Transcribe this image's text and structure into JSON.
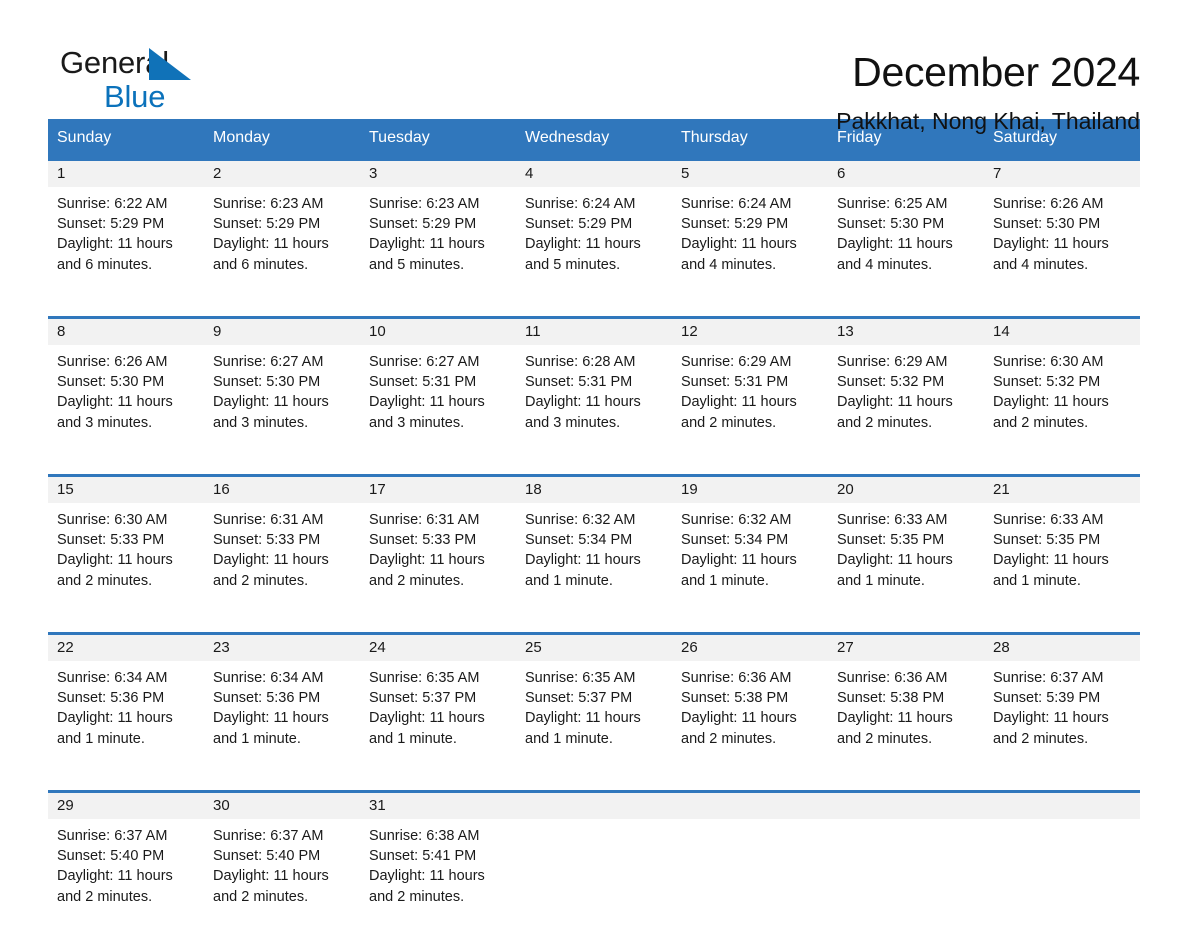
{
  "brand": {
    "name_part1": "General",
    "name_part2": "Blue",
    "triangle_icon": "triangle-icon",
    "accent_color": "#1072b8"
  },
  "header": {
    "title": "December 2024",
    "subtitle": "Pakkhat, Nong Khai, Thailand"
  },
  "theme": {
    "header_blue": "#3077bc",
    "day_band_gray": "#f2f2f2",
    "text": "#1a1a1a"
  },
  "weekdays": [
    "Sunday",
    "Monday",
    "Tuesday",
    "Wednesday",
    "Thursday",
    "Friday",
    "Saturday"
  ],
  "weeks": [
    [
      {
        "day": "1",
        "sunrise": "Sunrise: 6:22 AM",
        "sunset": "Sunset: 5:29 PM",
        "daylight": "Daylight: 11 hours and 6 minutes."
      },
      {
        "day": "2",
        "sunrise": "Sunrise: 6:23 AM",
        "sunset": "Sunset: 5:29 PM",
        "daylight": "Daylight: 11 hours and 6 minutes."
      },
      {
        "day": "3",
        "sunrise": "Sunrise: 6:23 AM",
        "sunset": "Sunset: 5:29 PM",
        "daylight": "Daylight: 11 hours and 5 minutes."
      },
      {
        "day": "4",
        "sunrise": "Sunrise: 6:24 AM",
        "sunset": "Sunset: 5:29 PM",
        "daylight": "Daylight: 11 hours and 5 minutes."
      },
      {
        "day": "5",
        "sunrise": "Sunrise: 6:24 AM",
        "sunset": "Sunset: 5:29 PM",
        "daylight": "Daylight: 11 hours and 4 minutes."
      },
      {
        "day": "6",
        "sunrise": "Sunrise: 6:25 AM",
        "sunset": "Sunset: 5:30 PM",
        "daylight": "Daylight: 11 hours and 4 minutes."
      },
      {
        "day": "7",
        "sunrise": "Sunrise: 6:26 AM",
        "sunset": "Sunset: 5:30 PM",
        "daylight": "Daylight: 11 hours and 4 minutes."
      }
    ],
    [
      {
        "day": "8",
        "sunrise": "Sunrise: 6:26 AM",
        "sunset": "Sunset: 5:30 PM",
        "daylight": "Daylight: 11 hours and 3 minutes."
      },
      {
        "day": "9",
        "sunrise": "Sunrise: 6:27 AM",
        "sunset": "Sunset: 5:30 PM",
        "daylight": "Daylight: 11 hours and 3 minutes."
      },
      {
        "day": "10",
        "sunrise": "Sunrise: 6:27 AM",
        "sunset": "Sunset: 5:31 PM",
        "daylight": "Daylight: 11 hours and 3 minutes."
      },
      {
        "day": "11",
        "sunrise": "Sunrise: 6:28 AM",
        "sunset": "Sunset: 5:31 PM",
        "daylight": "Daylight: 11 hours and 3 minutes."
      },
      {
        "day": "12",
        "sunrise": "Sunrise: 6:29 AM",
        "sunset": "Sunset: 5:31 PM",
        "daylight": "Daylight: 11 hours and 2 minutes."
      },
      {
        "day": "13",
        "sunrise": "Sunrise: 6:29 AM",
        "sunset": "Sunset: 5:32 PM",
        "daylight": "Daylight: 11 hours and 2 minutes."
      },
      {
        "day": "14",
        "sunrise": "Sunrise: 6:30 AM",
        "sunset": "Sunset: 5:32 PM",
        "daylight": "Daylight: 11 hours and 2 minutes."
      }
    ],
    [
      {
        "day": "15",
        "sunrise": "Sunrise: 6:30 AM",
        "sunset": "Sunset: 5:33 PM",
        "daylight": "Daylight: 11 hours and 2 minutes."
      },
      {
        "day": "16",
        "sunrise": "Sunrise: 6:31 AM",
        "sunset": "Sunset: 5:33 PM",
        "daylight": "Daylight: 11 hours and 2 minutes."
      },
      {
        "day": "17",
        "sunrise": "Sunrise: 6:31 AM",
        "sunset": "Sunset: 5:33 PM",
        "daylight": "Daylight: 11 hours and 2 minutes."
      },
      {
        "day": "18",
        "sunrise": "Sunrise: 6:32 AM",
        "sunset": "Sunset: 5:34 PM",
        "daylight": "Daylight: 11 hours and 1 minute."
      },
      {
        "day": "19",
        "sunrise": "Sunrise: 6:32 AM",
        "sunset": "Sunset: 5:34 PM",
        "daylight": "Daylight: 11 hours and 1 minute."
      },
      {
        "day": "20",
        "sunrise": "Sunrise: 6:33 AM",
        "sunset": "Sunset: 5:35 PM",
        "daylight": "Daylight: 11 hours and 1 minute."
      },
      {
        "day": "21",
        "sunrise": "Sunrise: 6:33 AM",
        "sunset": "Sunset: 5:35 PM",
        "daylight": "Daylight: 11 hours and 1 minute."
      }
    ],
    [
      {
        "day": "22",
        "sunrise": "Sunrise: 6:34 AM",
        "sunset": "Sunset: 5:36 PM",
        "daylight": "Daylight: 11 hours and 1 minute."
      },
      {
        "day": "23",
        "sunrise": "Sunrise: 6:34 AM",
        "sunset": "Sunset: 5:36 PM",
        "daylight": "Daylight: 11 hours and 1 minute."
      },
      {
        "day": "24",
        "sunrise": "Sunrise: 6:35 AM",
        "sunset": "Sunset: 5:37 PM",
        "daylight": "Daylight: 11 hours and 1 minute."
      },
      {
        "day": "25",
        "sunrise": "Sunrise: 6:35 AM",
        "sunset": "Sunset: 5:37 PM",
        "daylight": "Daylight: 11 hours and 1 minute."
      },
      {
        "day": "26",
        "sunrise": "Sunrise: 6:36 AM",
        "sunset": "Sunset: 5:38 PM",
        "daylight": "Daylight: 11 hours and 2 minutes."
      },
      {
        "day": "27",
        "sunrise": "Sunrise: 6:36 AM",
        "sunset": "Sunset: 5:38 PM",
        "daylight": "Daylight: 11 hours and 2 minutes."
      },
      {
        "day": "28",
        "sunrise": "Sunrise: 6:37 AM",
        "sunset": "Sunset: 5:39 PM",
        "daylight": "Daylight: 11 hours and 2 minutes."
      }
    ],
    [
      {
        "day": "29",
        "sunrise": "Sunrise: 6:37 AM",
        "sunset": "Sunset: 5:40 PM",
        "daylight": "Daylight: 11 hours and 2 minutes."
      },
      {
        "day": "30",
        "sunrise": "Sunrise: 6:37 AM",
        "sunset": "Sunset: 5:40 PM",
        "daylight": "Daylight: 11 hours and 2 minutes."
      },
      {
        "day": "31",
        "sunrise": "Sunrise: 6:38 AM",
        "sunset": "Sunset: 5:41 PM",
        "daylight": "Daylight: 11 hours and 2 minutes."
      },
      {
        "day": "",
        "sunrise": "",
        "sunset": "",
        "daylight": ""
      },
      {
        "day": "",
        "sunrise": "",
        "sunset": "",
        "daylight": ""
      },
      {
        "day": "",
        "sunrise": "",
        "sunset": "",
        "daylight": ""
      },
      {
        "day": "",
        "sunrise": "",
        "sunset": "",
        "daylight": ""
      }
    ]
  ]
}
